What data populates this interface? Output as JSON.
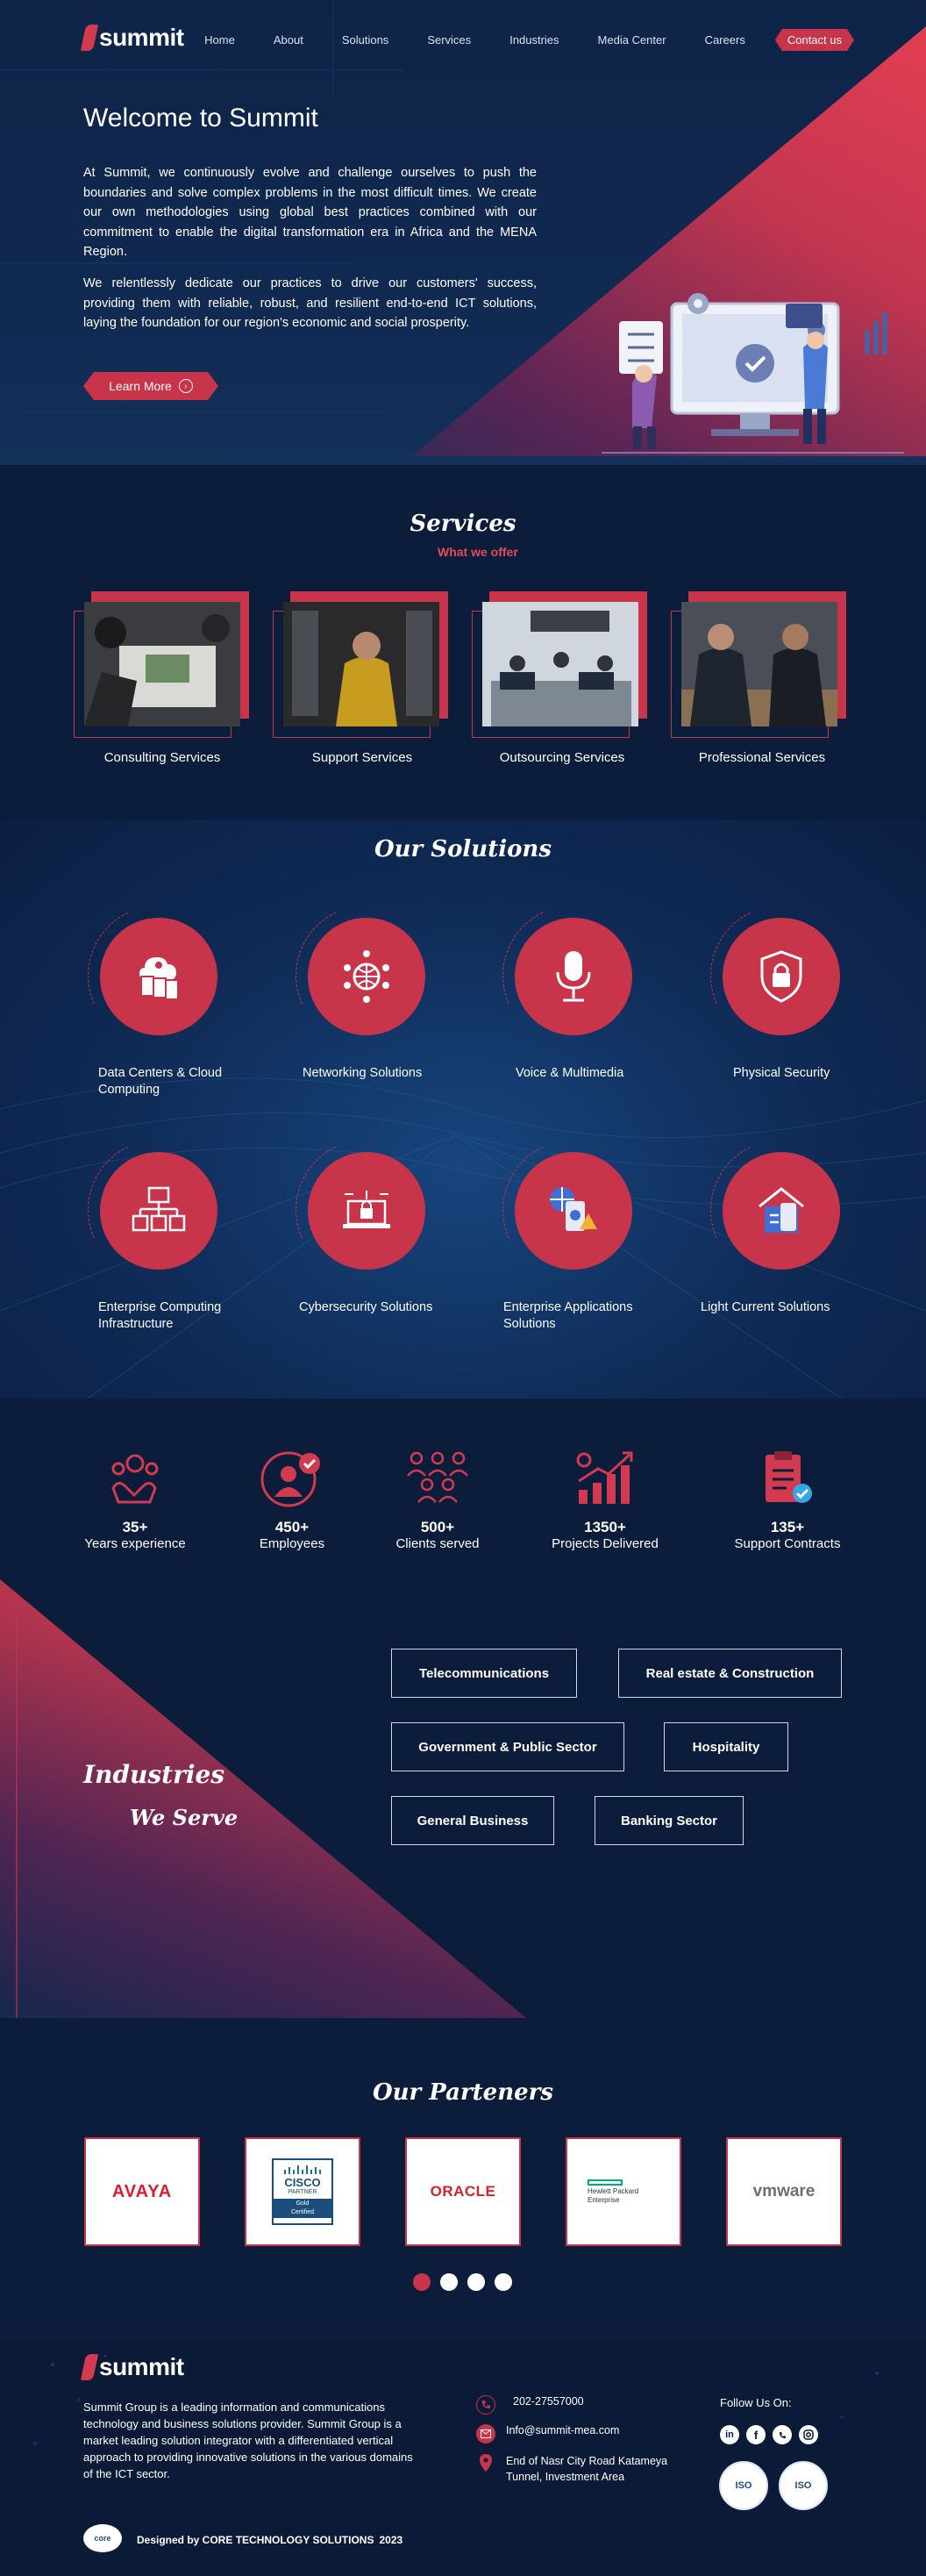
{
  "nav": {
    "logo": "summit",
    "links": [
      "Home",
      "About",
      "Solutions",
      "Services",
      "Industries",
      "Media Center",
      "Careers"
    ],
    "cta": "Contact us"
  },
  "hero": {
    "title": "Welcome to Summit",
    "p1": "At Summit, we continuously evolve and challenge ourselves to push the boundaries and solve complex problems in the most difficult times. We create our own methodologies using global best practices combined with our commitment to enable the digital transformation era in Africa and the MENA Region.",
    "p2": "We relentlessly dedicate our practices to drive our customers' success, providing them with reliable, robust, and resilient end-to-end ICT solutions, laying the foundation for our region's economic and social prosperity.",
    "button": "Learn More"
  },
  "services": {
    "title": "Services",
    "subtitle": "What we offer",
    "items": [
      "Consulting Services",
      "Support Services",
      "Outsourcing Services",
      "Professional Services"
    ]
  },
  "solutions": {
    "title": "Our Solutions",
    "items": [
      "Data Centers & Cloud Computing",
      "Networking Solutions",
      "Voice & Multimedia",
      "Physical Security",
      "Enterprise Computing Infrastructure",
      "Cybersecurity Solutions",
      "Enterprise Applications Solutions",
      "Light Current Solutions"
    ]
  },
  "stats": [
    {
      "num": "35+",
      "label": "Years experience"
    },
    {
      "num": "450+",
      "label": "Employees"
    },
    {
      "num": "500+",
      "label": "Clients served"
    },
    {
      "num": "1350+",
      "label": "Projects Delivered"
    },
    {
      "num": "135+",
      "label": "Support Contracts"
    }
  ],
  "industries": {
    "title1": "Industries",
    "title2": "We Serve",
    "items": [
      "Telecommunications",
      "Real estate & Construction",
      "Government & Public Sector",
      "Hospitality",
      "General Business",
      "Banking Sector"
    ]
  },
  "partners": {
    "title": "Our Parteners",
    "logos": [
      "AVAYA",
      "CISCO",
      "ORACLE",
      "Hewlett Packard Enterprise",
      "vmware"
    ],
    "cisco_sub": "PARTNER",
    "cisco_tier": "Gold",
    "cisco_cert": "Certified",
    "carousel_pages": 4
  },
  "footer": {
    "logo": "summit",
    "about": "Summit Group is a leading information and communications technology and business solutions provider. Summit Group is a market leading solution integrator with a differentiated vertical approach to providing innovative solutions in the various domains of the ICT sector.",
    "phone": "202-27557000",
    "email": "Info@summit-mea.com",
    "address": "End of Nasr City Road Katameya Tunnel, Investment Area",
    "follow": "Follow Us On:",
    "credit": "Designed by CORE TECHNOLOGY SOLUTIONS",
    "year": "2023",
    "iso_labels": [
      "ISO",
      "ISO"
    ],
    "credit_badge": "core"
  },
  "colors": {
    "accent": "#c8344a",
    "background": "#0c1d3c"
  }
}
